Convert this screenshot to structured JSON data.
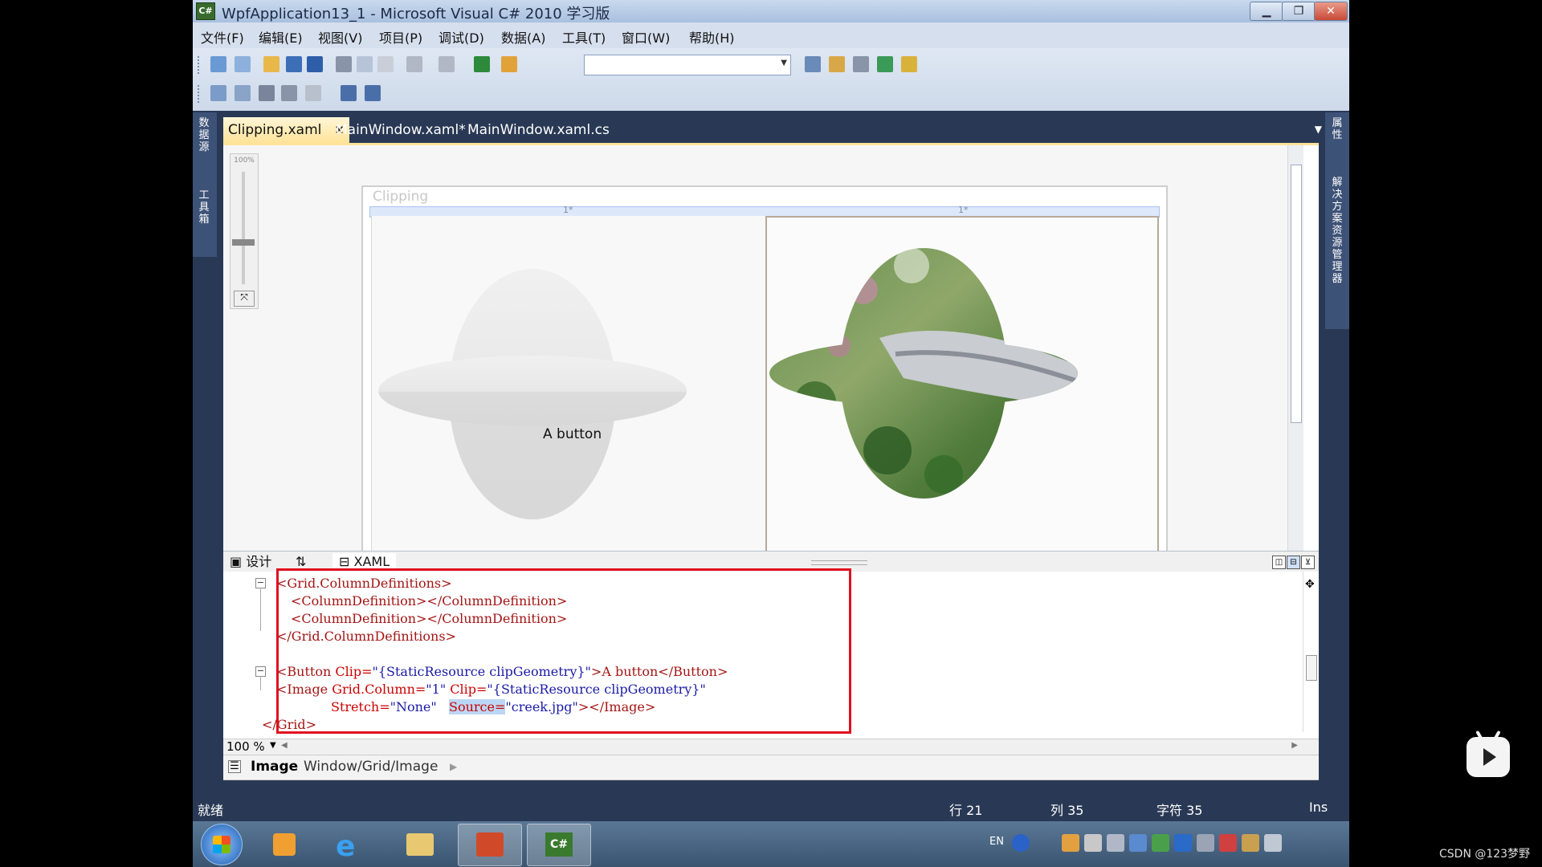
{
  "window": {
    "title": "WpfApplication13_1 - Microsoft Visual C# 2010 学习版",
    "app_icon_label": "C#",
    "minimize_glyph": "▁",
    "maximize_glyph": "❐",
    "close_glyph": "✕"
  },
  "menu": [
    "文件(F)",
    "编辑(E)",
    "视图(V)",
    "项目(P)",
    "调试(D)",
    "数据(A)",
    "工具(T)",
    "窗口(W)",
    "帮助(H)"
  ],
  "left_panel": {
    "item1": "数据源",
    "item2": "工具箱"
  },
  "right_panel": {
    "item1": "属性",
    "item2": "解决方案资源管理器"
  },
  "tabs": [
    {
      "label": "Clipping.xaml",
      "close": "✕"
    },
    {
      "label": "MainWindow.xaml*"
    },
    {
      "label": "MainWindow.xaml.cs"
    }
  ],
  "designer": {
    "zoom_label": "100%",
    "window_caption": "Clipping",
    "col1_star": "1*",
    "col2_star": "1*",
    "button_text": "A button"
  },
  "split": {
    "design_tab": "设计",
    "swap": "⇅",
    "xaml_tab": "XAML"
  },
  "code_lines": {
    "l1": "<Grid.ColumnDefinitions>",
    "l2": "<ColumnDefinition></ColumnDefinition>",
    "l3": "<ColumnDefinition></ColumnDefinition>",
    "l4": "</Grid.ColumnDefinitions>",
    "l6a": "<Button",
    "l6b": " Clip=",
    "l6c": "\"{StaticResource clipGeometry}\"",
    "l6d": ">A button</Button>",
    "l7a": "<Image",
    "l7b": " Grid.Column=",
    "l7c": "\"1\"",
    "l7d": " Clip=",
    "l7e": "\"{StaticResource clipGeometry}\"",
    "l8a": "Stretch=",
    "l8b": "\"None\"",
    "l8c": "Source=",
    "l8d": "\"creek.jpg\"",
    "l8e": "></Image>",
    "l9": "</Grid>"
  },
  "zoom": {
    "value": "100 %"
  },
  "path": {
    "element": "Image",
    "breadcrumb": "Window/Grid/Image"
  },
  "status": {
    "ready": "就绪",
    "line": "行 21",
    "col": "列 35",
    "char": "字符 35",
    "mode": "Ins"
  },
  "taskbar": {
    "tray_lang": "EN"
  },
  "watermark": "CSDN @123梦野",
  "colors": {
    "accent_red": "#e01020",
    "vs_blue": "#293955",
    "tab_active": "#ffe39a"
  }
}
